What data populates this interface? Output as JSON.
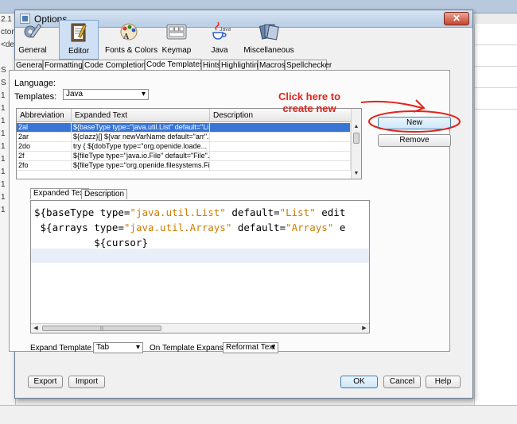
{
  "background": {
    "left_strip": [
      "2.1",
      "ctor",
      "<def",
      "",
      "S",
      "S",
      "1",
      "1",
      "1",
      "1",
      "1",
      "1",
      "1",
      "1",
      "1",
      "1"
    ]
  },
  "dialog": {
    "title": "Options",
    "close_glyph": "✕"
  },
  "categories": [
    {
      "label": "General",
      "icon": "general-icon"
    },
    {
      "label": "Editor",
      "icon": "editor-icon",
      "selected": true
    },
    {
      "label": "Fonts & Colors",
      "icon": "fonts-colors-icon"
    },
    {
      "label": "Keymap",
      "icon": "keymap-icon"
    },
    {
      "label": "Java",
      "icon": "java-icon"
    },
    {
      "label": "Miscellaneous",
      "icon": "miscellaneous-icon"
    }
  ],
  "tabs": [
    "General",
    "Formatting",
    "Code Completion",
    "Code Templates",
    "Hints",
    "Highlighting",
    "Macros",
    "Spellchecker"
  ],
  "selected_tab": "Code Templates",
  "language": {
    "label": "Language:",
    "value": "Java"
  },
  "templates_label": "Templates:",
  "table": {
    "columns": [
      "Abbreviation",
      "Expanded Text",
      "Description"
    ],
    "rows": [
      [
        "2al",
        "${baseType type=\"java.util.List\" default=\"Li...",
        ""
      ],
      [
        "2ar",
        "${clazz}[] ${var newVarName default=\"arr\"...",
        ""
      ],
      [
        "2do",
        "try {    ${dobType type=\"org.openide.loade...",
        ""
      ],
      [
        "2f",
        "${fileType type=\"java.io.File\" default=\"File\"...",
        ""
      ],
      [
        "2fo",
        "${fileType type=\"org.openide.filesystems.Fi...",
        ""
      ]
    ],
    "selected_row": 0
  },
  "buttons": {
    "new": "New",
    "remove": "Remove",
    "export": "Export",
    "import": "Import",
    "ok": "OK",
    "cancel": "Cancel",
    "help": "Help"
  },
  "annotation": {
    "line1": "Click here to",
    "line2": "create new",
    "color": "#e0241c"
  },
  "inner_tabs": [
    "Expanded Text",
    "Description"
  ],
  "editor": {
    "lines": [
      [
        {
          "t": "${baseType type=",
          "c": "kw"
        },
        {
          "t": "\"java.util.List\"",
          "c": "str"
        },
        {
          "t": " default=",
          "c": "kw"
        },
        {
          "t": "\"List\"",
          "c": "str"
        },
        {
          "t": " edit",
          "c": "kw"
        }
      ],
      [
        {
          "t": " ${arrays type=",
          "c": "kw"
        },
        {
          "t": "\"java.util.Arrays\"",
          "c": "str"
        },
        {
          "t": " default=",
          "c": "kw"
        },
        {
          "t": "\"Arrays\"",
          "c": "str"
        },
        {
          "t": " e",
          "c": "kw"
        }
      ],
      [
        {
          "t": "          ${cursor}",
          "c": "kw"
        }
      ]
    ],
    "scroll_grip": "|||"
  },
  "expand_on": {
    "label": "Expand Template on:",
    "value": "Tab"
  },
  "on_expansion": {
    "label": "On Template Expansion:",
    "value": "Reformat Text"
  },
  "colors": {
    "selection": "#3875d7",
    "title_gradient_top": "#d7e4f2"
  }
}
